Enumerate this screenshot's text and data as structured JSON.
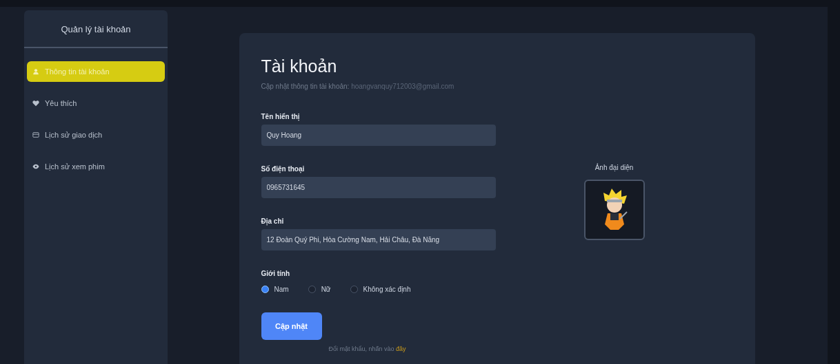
{
  "sidebar": {
    "title": "Quản lý tài khoản",
    "items": [
      {
        "label": "Thông tin tài khoản",
        "selected": true
      },
      {
        "label": "Yêu thích",
        "selected": false
      },
      {
        "label": "Lịch sử giao dịch",
        "selected": false
      },
      {
        "label": "Lịch sử xem phim",
        "selected": false
      }
    ]
  },
  "account": {
    "title": "Tài khoản",
    "subtitle": "Cập nhật thông tin tài khoản:",
    "email": "hoangvanquy712003@gmail.com",
    "fields": [
      {
        "label": "Tên hiển thị",
        "value": "Quy Hoang"
      },
      {
        "label": "Số điện thoại",
        "value": "0965731645"
      },
      {
        "label": "Địa chỉ",
        "value": "12 Đoàn Quý Phi, Hòa Cường Nam, Hải Châu, Đà Nẵng"
      }
    ],
    "gender": {
      "label": "Giới tính",
      "options": [
        {
          "label": "Nam",
          "selected": true
        },
        {
          "label": "Nữ",
          "selected": false
        },
        {
          "label": "Không xác định",
          "selected": false
        }
      ]
    },
    "submit": "Cập nhật",
    "password_note": "Đổi mật khẩu, nhấn vào",
    "password_link": "đây",
    "avatar_label": "Ảnh đại diện"
  }
}
